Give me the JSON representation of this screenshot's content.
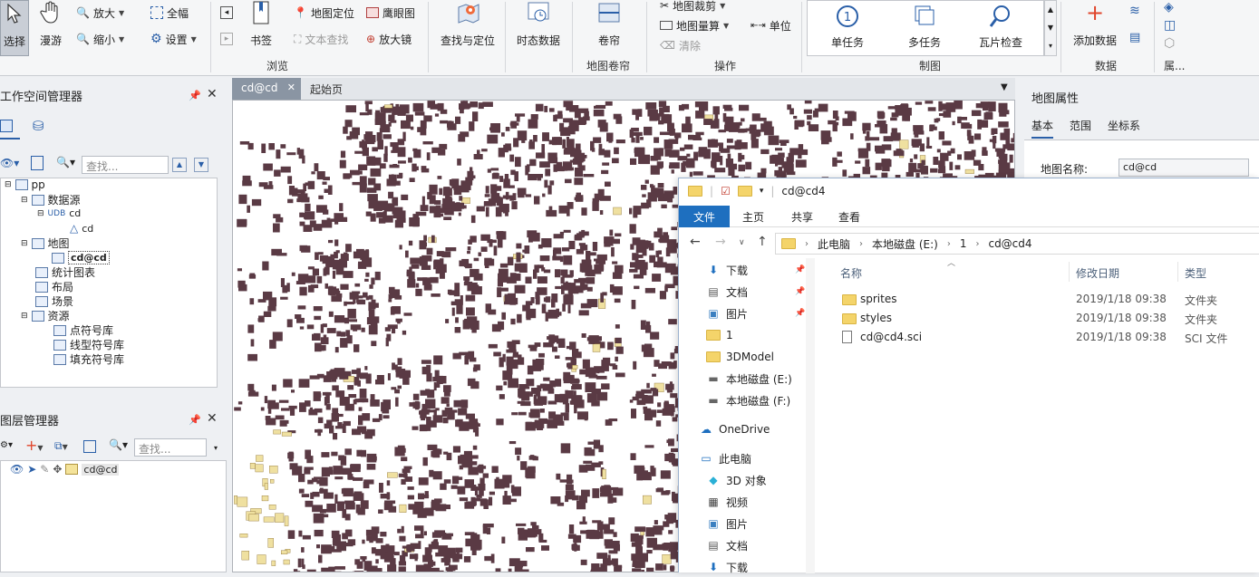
{
  "ribbon": {
    "select": "选择",
    "pan": "漫游",
    "zoom_in": "放大",
    "zoom_out": "缩小",
    "full_extent": "全幅",
    "settings": "设置",
    "bookmark": "书签",
    "locate": "地图定位",
    "eagle_eye": "鹰眼图",
    "text_find": "文本查找",
    "magnifier": "放大镜",
    "find_locate": "查找与定位",
    "temporal": "时态数据",
    "browse_group": "浏览",
    "swipe": "卷帘",
    "swipe_group": "地图卷帘",
    "clip": "地图裁剪",
    "measure": "地图量算",
    "unit": "单位",
    "clear": "清除",
    "operate_group": "操作",
    "single_task": "单任务",
    "multi_task": "多任务",
    "tile_check": "瓦片检查",
    "tile_group": "制图",
    "add_data": "添加数据",
    "data_group": "数据",
    "more_label": "属..."
  },
  "workspace": {
    "title": "工作空间管理器",
    "search_placeholder": "查找...",
    "tree": {
      "root": "pp",
      "datasources": "数据源",
      "ds_cd": "cd",
      "dataset_cd": "cd",
      "maps": "地图",
      "map_cd": "cd@cd",
      "charts": "统计图表",
      "layouts": "布局",
      "scenes": "场景",
      "resources": "资源",
      "point_symbols": "点符号库",
      "line_symbols": "线型符号库",
      "fill_symbols": "填充符号库"
    }
  },
  "layers": {
    "title": "图层管理器",
    "search_placeholder": "查找...",
    "layer_name": "cd@cd"
  },
  "doc_tabs": {
    "active": "cd@cd",
    "start": "起始页"
  },
  "map_props": {
    "title": "地图属性",
    "tabs": [
      "基本",
      "范围",
      "坐标系"
    ],
    "name_label": "地图名称:",
    "name_value": "cd@cd"
  },
  "explorer": {
    "title": "cd@cd4",
    "tabs": [
      "文件",
      "主页",
      "共享",
      "查看"
    ],
    "breadcrumb": [
      "此电脑",
      "本地磁盘 (E:)",
      "1",
      "cd@cd4"
    ],
    "nav": [
      {
        "label": "下载",
        "icon": "download-icon",
        "pinned": true
      },
      {
        "label": "文档",
        "icon": "document-icon",
        "pinned": true
      },
      {
        "label": "图片",
        "icon": "picture-icon",
        "pinned": true
      },
      {
        "label": "1",
        "icon": "folder-icon",
        "pinned": false
      },
      {
        "label": "3DModel",
        "icon": "folder-icon",
        "pinned": false
      },
      {
        "label": "本地磁盘 (E:)",
        "icon": "drive-icon",
        "pinned": false
      },
      {
        "label": "本地磁盘 (F:)",
        "icon": "drive-icon",
        "pinned": false
      },
      {
        "label": "OneDrive",
        "icon": "cloud-icon",
        "pinned": false
      },
      {
        "label": "此电脑",
        "icon": "computer-icon",
        "pinned": false
      },
      {
        "label": "3D 对象",
        "icon": "cube-icon",
        "pinned": false
      },
      {
        "label": "视频",
        "icon": "video-icon",
        "pinned": false
      },
      {
        "label": "图片",
        "icon": "picture-icon",
        "pinned": false
      },
      {
        "label": "文档",
        "icon": "document-icon",
        "pinned": false
      },
      {
        "label": "下载",
        "icon": "download-icon",
        "pinned": false
      }
    ],
    "columns": {
      "name": "名称",
      "modified": "修改日期",
      "type": "类型"
    },
    "files": [
      {
        "name": "sprites",
        "modified": "2019/1/18 09:38",
        "type": "文件夹",
        "icon": "folder-icon"
      },
      {
        "name": "styles",
        "modified": "2019/1/18 09:38",
        "type": "文件夹",
        "icon": "folder-icon"
      },
      {
        "name": "cd@cd4.sci",
        "modified": "2019/1/18 09:38",
        "type": "SCI 文件",
        "icon": "file-icon"
      }
    ]
  },
  "colors": {
    "map_features": "#5a3a44",
    "map_highlight": "#efe0a0",
    "explorer_ribbon": "#1e6fbf"
  }
}
